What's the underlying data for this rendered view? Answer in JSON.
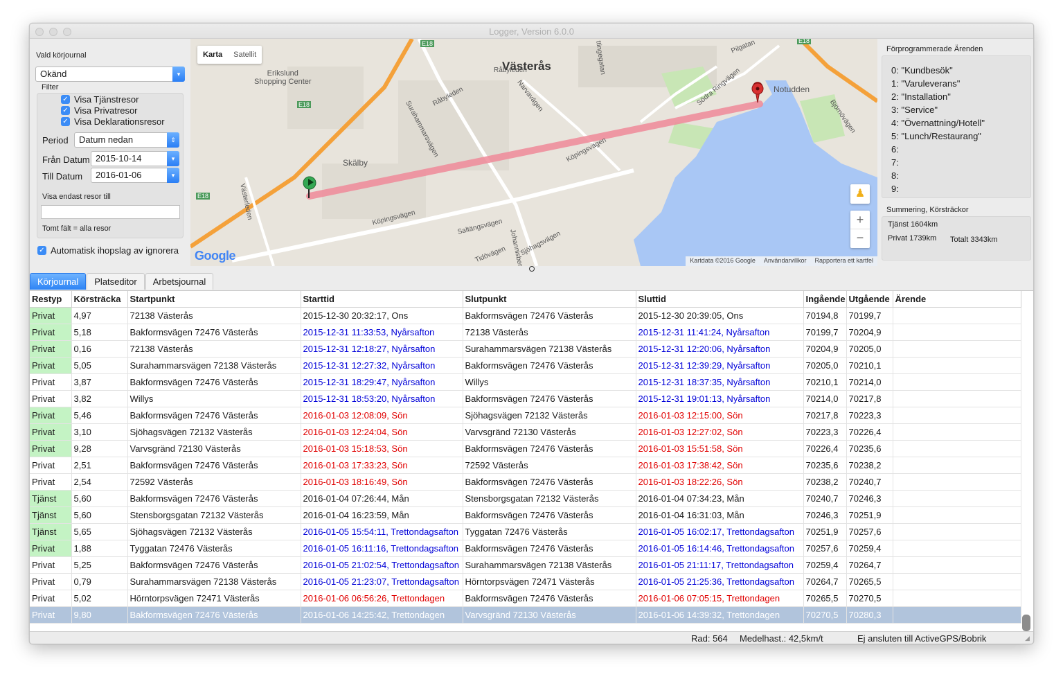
{
  "window": {
    "title": "Logger, Version 6.0.0"
  },
  "left": {
    "journal_label": "Vald körjournal",
    "journal_value": "Okänd",
    "filter_label": "Filter",
    "checkboxes": [
      "Visa Tjänstresor",
      "Visa Privatresor",
      "Visa Deklarationsresor"
    ],
    "period_label": "Period",
    "period_value": "Datum nedan",
    "from_label": "Från Datum",
    "from_value": "2015-10-14",
    "to_label": "Till Datum",
    "to_value": "2016-01-06",
    "only_label": "Visa endast resor till",
    "only_value": "",
    "empty_hint": "Tomt fält = alla resor",
    "auto_merge": "Automatisk ihopslag av ignorera"
  },
  "map": {
    "type_map": "Karta",
    "type_satellite": "Satellit",
    "labels": {
      "city": "Västerås",
      "erikslund": "Erikslund\nShopping Center",
      "skalby": "Skälby",
      "notudden": "Notudden",
      "e18_a": "E18",
      "e18_b": "E18",
      "e18_c": "E18",
      "e18_d": "E18",
      "surahammarsvagen": "Surahammarsvägen",
      "rabyleden": "Råbyleden",
      "rabyleden2": "Råbyleden",
      "narvavagen": "Narvavägen",
      "koppingsvagen": "Köpingsvägen",
      "koppingsvagen2": "Köpingsvägen",
      "vasterleden": "Västerleden",
      "saltangsvagen": "Saltängsvägen",
      "johannisberg": "Johannisber",
      "sjohagsvagen": "Sjöhagsvägen",
      "tidovagen": "Tidövägen",
      "sodra_ringvagen": "Södra Ringvägen",
      "pilgatan": "Pilgatan",
      "bjornovagen": "Björnövägen",
      "ettingegatan": "ttingegatan"
    },
    "footer": [
      "Kartdata ©2016 Google",
      "Användarvillkor",
      "Rapportera ett kartfel"
    ],
    "logo": "Google",
    "zoom_in": "+",
    "zoom_out": "−",
    "colors": {
      "route": "#f08a9a",
      "water": "#a9c7f5",
      "highway": "#f4a13a"
    }
  },
  "right": {
    "arenden_title": "Förprogrammerade Ärenden",
    "arenden": [
      "0: \"Kundbesök\"",
      "1: \"Varuleverans\"",
      "2: \"Installation\"",
      "3: \"Service\"",
      "4: \"Övernattning/Hotell\"",
      "5: \"Lunch/Restaurang\"",
      "6:",
      "7:",
      "8:",
      "9:"
    ],
    "summary_title": "Summering, Körsträckor",
    "tjanst": "Tjänst 1604km",
    "privat": "Privat 1739km",
    "totalt": "Totalt 3343km"
  },
  "tabs": [
    "Körjournal",
    "Platseditor",
    "Arbetsjournal"
  ],
  "table": {
    "headers": [
      "Restyp",
      "Körsträcka",
      "Startpunkt",
      "Starttid",
      "Slutpunkt",
      "Sluttid",
      "Ingående",
      "Utgående",
      "Ärende"
    ],
    "rows": [
      {
        "restyp": "Privat",
        "green": true,
        "dist": "4,97",
        "start": "72138 Västerås",
        "starttid": "2015-12-30 20:32:17, Ons",
        "tc": "",
        "slut": "Bakformsvägen 72476 Västerås",
        "sluttid": "2015-12-30 20:39:05, Ons",
        "in": "70194,8",
        "out": "70199,7",
        "arende": ""
      },
      {
        "restyp": "Privat",
        "green": true,
        "dist": "5,18",
        "start": "Bakformsvägen 72476 Västerås",
        "starttid": "2015-12-31 11:33:53, Nyårsafton",
        "tc": "blue",
        "slut": "72138 Västerås",
        "sluttid": "2015-12-31 11:41:24, Nyårsafton",
        "in": "70199,7",
        "out": "70204,9",
        "arende": ""
      },
      {
        "restyp": "Privat",
        "green": true,
        "dist": "0,16",
        "start": "72138 Västerås",
        "starttid": "2015-12-31 12:18:27, Nyårsafton",
        "tc": "blue",
        "slut": "Surahammarsvägen 72138 Västerås",
        "sluttid": "2015-12-31 12:20:06, Nyårsafton",
        "in": "70204,9",
        "out": "70205,0",
        "arende": ""
      },
      {
        "restyp": "Privat",
        "green": true,
        "dist": "5,05",
        "start": "Surahammarsvägen 72138 Västerås",
        "starttid": "2015-12-31 12:27:32, Nyårsafton",
        "tc": "blue",
        "slut": "Bakformsvägen 72476 Västerås",
        "sluttid": "2015-12-31 12:39:29, Nyårsafton",
        "in": "70205,0",
        "out": "70210,1",
        "arende": ""
      },
      {
        "restyp": "Privat",
        "green": false,
        "dist": "3,87",
        "start": "Bakformsvägen 72476 Västerås",
        "starttid": "2015-12-31 18:29:47, Nyårsafton",
        "tc": "blue",
        "slut": "Willys",
        "sluttid": "2015-12-31 18:37:35, Nyårsafton",
        "in": "70210,1",
        "out": "70214,0",
        "arende": ""
      },
      {
        "restyp": "Privat",
        "green": false,
        "dist": "3,82",
        "start": "Willys",
        "starttid": "2015-12-31 18:53:20, Nyårsafton",
        "tc": "blue",
        "slut": "Bakformsvägen 72476 Västerås",
        "sluttid": "2015-12-31 19:01:13, Nyårsafton",
        "in": "70214,0",
        "out": "70217,8",
        "arende": ""
      },
      {
        "restyp": "Privat",
        "green": true,
        "dist": "5,46",
        "start": "Bakformsvägen 72476 Västerås",
        "starttid": "2016-01-03 12:08:09, Sön",
        "tc": "red",
        "slut": "Sjöhagsvägen 72132 Västerås",
        "sluttid": "2016-01-03 12:15:00, Sön",
        "in": "70217,8",
        "out": "70223,3",
        "arende": ""
      },
      {
        "restyp": "Privat",
        "green": true,
        "dist": "3,10",
        "start": "Sjöhagsvägen 72132 Västerås",
        "starttid": "2016-01-03 12:24:04, Sön",
        "tc": "red",
        "slut": "Varvsgränd 72130 Västerås",
        "sluttid": "2016-01-03 12:27:02, Sön",
        "in": "70223,3",
        "out": "70226,4",
        "arende": ""
      },
      {
        "restyp": "Privat",
        "green": true,
        "dist": "9,28",
        "start": "Varvsgränd 72130 Västerås",
        "starttid": "2016-01-03 15:18:53, Sön",
        "tc": "red",
        "slut": "Bakformsvägen 72476 Västerås",
        "sluttid": "2016-01-03 15:51:58, Sön",
        "in": "70226,4",
        "out": "70235,6",
        "arende": ""
      },
      {
        "restyp": "Privat",
        "green": false,
        "dist": "2,51",
        "start": "Bakformsvägen 72476 Västerås",
        "starttid": "2016-01-03 17:33:23, Sön",
        "tc": "red",
        "slut": "72592 Västerås",
        "sluttid": "2016-01-03 17:38:42, Sön",
        "in": "70235,6",
        "out": "70238,2",
        "arende": ""
      },
      {
        "restyp": "Privat",
        "green": false,
        "dist": "2,54",
        "start": "72592 Västerås",
        "starttid": "2016-01-03 18:16:49, Sön",
        "tc": "red",
        "slut": "Bakformsvägen 72476 Västerås",
        "sluttid": "2016-01-03 18:22:26, Sön",
        "in": "70238,2",
        "out": "70240,7",
        "arende": ""
      },
      {
        "restyp": "Tjänst",
        "green": true,
        "dist": "5,60",
        "start": "Bakformsvägen 72476 Västerås",
        "starttid": "2016-01-04 07:26:44, Mån",
        "tc": "",
        "slut": "Stensborgsgatan 72132 Västerås",
        "sluttid": "2016-01-04 07:34:23, Mån",
        "in": "70240,7",
        "out": "70246,3",
        "arende": ""
      },
      {
        "restyp": "Tjänst",
        "green": true,
        "dist": "5,60",
        "start": "Stensborgsgatan 72132 Västerås",
        "starttid": "2016-01-04 16:23:59, Mån",
        "tc": "",
        "slut": "Bakformsvägen 72476 Västerås",
        "sluttid": "2016-01-04 16:31:03, Mån",
        "in": "70246,3",
        "out": "70251,9",
        "arende": ""
      },
      {
        "restyp": "Tjänst",
        "green": true,
        "dist": "5,65",
        "start": "Sjöhagsvägen 72132 Västerås",
        "starttid": "2016-01-05 15:54:11, Trettondagsafton",
        "tc": "blue",
        "slut": "Tyggatan 72476 Västerås",
        "sluttid": "2016-01-05 16:02:17, Trettondagsafton",
        "in": "70251,9",
        "out": "70257,6",
        "arende": ""
      },
      {
        "restyp": "Privat",
        "green": true,
        "dist": "1,88",
        "start": "Tyggatan 72476 Västerås",
        "starttid": "2016-01-05 16:11:16, Trettondagsafton",
        "tc": "blue",
        "slut": "Bakformsvägen 72476 Västerås",
        "sluttid": "2016-01-05 16:14:46, Trettondagsafton",
        "in": "70257,6",
        "out": "70259,4",
        "arende": ""
      },
      {
        "restyp": "Privat",
        "green": false,
        "dist": "5,25",
        "start": "Bakformsvägen 72476 Västerås",
        "starttid": "2016-01-05 21:02:54, Trettondagsafton",
        "tc": "blue",
        "slut": "Surahammarsvägen 72138 Västerås",
        "sluttid": "2016-01-05 21:11:17, Trettondagsafton",
        "in": "70259,4",
        "out": "70264,7",
        "arende": ""
      },
      {
        "restyp": "Privat",
        "green": false,
        "dist": "0,79",
        "start": "Surahammarsvägen 72138 Västerås",
        "starttid": "2016-01-05 21:23:07, Trettondagsafton",
        "tc": "blue",
        "slut": "Hörntorpsvägen 72471 Västerås",
        "sluttid": "2016-01-05 21:25:36, Trettondagsafton",
        "in": "70264,7",
        "out": "70265,5",
        "arende": ""
      },
      {
        "restyp": "Privat",
        "green": false,
        "dist": "5,02",
        "start": "Hörntorpsvägen 72471 Västerås",
        "starttid": "2016-01-06 06:56:26, Trettondagen",
        "tc": "red",
        "slut": "Bakformsvägen 72476 Västerås",
        "sluttid": "2016-01-06 07:05:15, Trettondagen",
        "in": "70265,5",
        "out": "70270,5",
        "arende": ""
      },
      {
        "restyp": "Privat",
        "green": false,
        "selected": true,
        "dist": "9,80",
        "start": "Bakformsvägen 72476 Västerås",
        "starttid": "2016-01-06 14:25:42, Trettondagen",
        "tc": "",
        "slut": "Varvsgränd 72130 Västerås",
        "sluttid": "2016-01-06 14:39:32, Trettondagen",
        "in": "70270,5",
        "out": "70280,3",
        "arende": ""
      }
    ]
  },
  "status": {
    "rad": "Rad: 564",
    "medel": "Medelhast.: 42,5km/t",
    "gps": "Ej ansluten till ActiveGPS/Bobrik"
  }
}
